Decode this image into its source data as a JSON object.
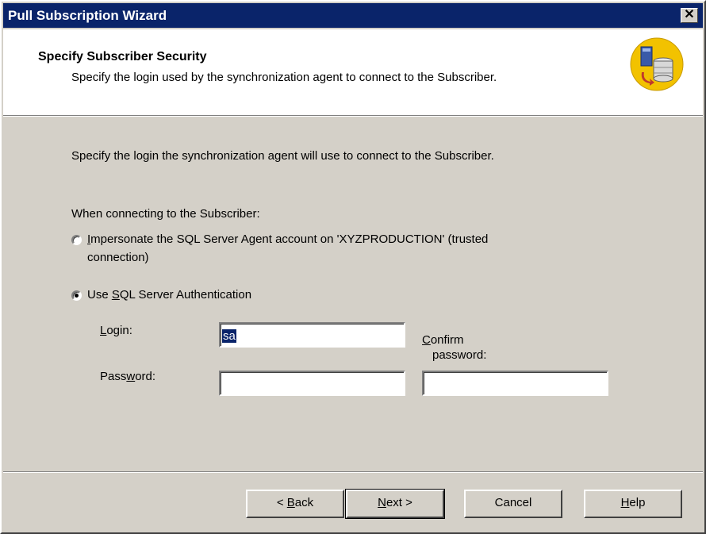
{
  "window": {
    "title": "Pull Subscription Wizard",
    "close_glyph": "✕"
  },
  "header": {
    "title": "Specify Subscriber Security",
    "subtitle": "Specify the login used by the synchronization agent to connect to the Subscriber.",
    "icon": "server-database-icon"
  },
  "body": {
    "intro": "Specify the login the synchronization agent will use to connect to the Subscriber.",
    "connecting_label": "When connecting to the Subscriber:",
    "option_impersonate": {
      "mnemonic": "I",
      "rest_line1": "mpersonate the SQL Server Agent account on 'XYZPRODUCTION' (trusted",
      "line2": "connection)",
      "selected": false
    },
    "option_sql_auth": {
      "before": "Use ",
      "mnemonic": "S",
      "after": "QL Server Authentication",
      "selected": true
    },
    "login": {
      "mnemonic": "L",
      "rest": "ogin:",
      "value": "sa"
    },
    "password": {
      "before": "Pass",
      "mnemonic": "w",
      "after": "ord:",
      "value": ""
    },
    "confirm_password": {
      "mnemonic": "C",
      "line1_rest": "onfirm",
      "line2": "password:",
      "value": ""
    }
  },
  "buttons": {
    "back": {
      "prefix": "< ",
      "mnemonic": "B",
      "rest": "ack"
    },
    "next": {
      "mnemonic": "N",
      "rest": "ext >"
    },
    "cancel": {
      "label": "Cancel"
    },
    "help": {
      "mnemonic": "H",
      "rest": "elp"
    }
  }
}
